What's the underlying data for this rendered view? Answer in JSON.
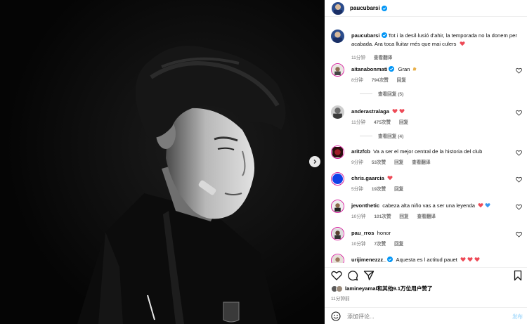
{
  "post": {
    "author": "paucubarsi",
    "caption": "Tot i la desil·lusió d'ahir, la temporada no la donem per acabada. Ara toca lluitar més que mai culers",
    "caption_time": "11分钟",
    "translate_label": "查看翻译"
  },
  "comments": [
    {
      "user": "aitanabonmati",
      "verified": true,
      "text": "Gran",
      "emoji": [
        "clap-icon"
      ],
      "time": "8分钟",
      "likes": "794次赞",
      "reply": "回复",
      "translate": "",
      "replies": "查看回复 (5)"
    },
    {
      "user": "anderastralaga",
      "verified": false,
      "text": "",
      "emoji": [
        "heart-icon",
        "heart-icon"
      ],
      "time": "11分钟",
      "likes": "475次赞",
      "reply": "回复",
      "translate": "",
      "replies": "查看回复 (4)"
    },
    {
      "user": "aritzfcb",
      "verified": false,
      "text": "Va a ser el mejor central de la historia del club",
      "emoji": [],
      "time": "9分钟",
      "likes": "53次赞",
      "reply": "回复",
      "translate": "查看翻译",
      "replies": ""
    },
    {
      "user": "chris.gaarcia",
      "verified": false,
      "text": "",
      "emoji": [
        "heart-icon"
      ],
      "time": "5分钟",
      "likes": "19次赞",
      "reply": "回复",
      "translate": "",
      "replies": ""
    },
    {
      "user": "jevonthetic",
      "verified": false,
      "text": "cabeza alta niño vas a ser una leyenda",
      "emoji": [
        "heart-icon",
        "blue-heart-icon"
      ],
      "time": "10分钟",
      "likes": "101次赞",
      "reply": "回复",
      "translate": "查看翻译",
      "replies": ""
    },
    {
      "user": "pau_rros",
      "verified": false,
      "text": "honor",
      "emoji": [],
      "time": "10分钟",
      "likes": "7次赞",
      "reply": "回复",
      "translate": "",
      "replies": ""
    },
    {
      "user": "urijimenezzz_",
      "verified": true,
      "text": "Aquesta es l actitud pauet",
      "emoji": [
        "heart-icon",
        "heart-icon",
        "heart-icon"
      ],
      "time": "",
      "likes": "",
      "reply": "",
      "translate": "",
      "replies": ""
    }
  ],
  "likes_summary": "lamineyamal和其他9.1万位用户赞了",
  "post_time": "11分钟前",
  "composer": {
    "placeholder": "添加评论...",
    "post_label": "发布"
  },
  "colors": {
    "verified": "#0095f6",
    "heart": "#ed4956",
    "blue_heart": "#3897f0",
    "post_disabled": "#b2dffc"
  }
}
